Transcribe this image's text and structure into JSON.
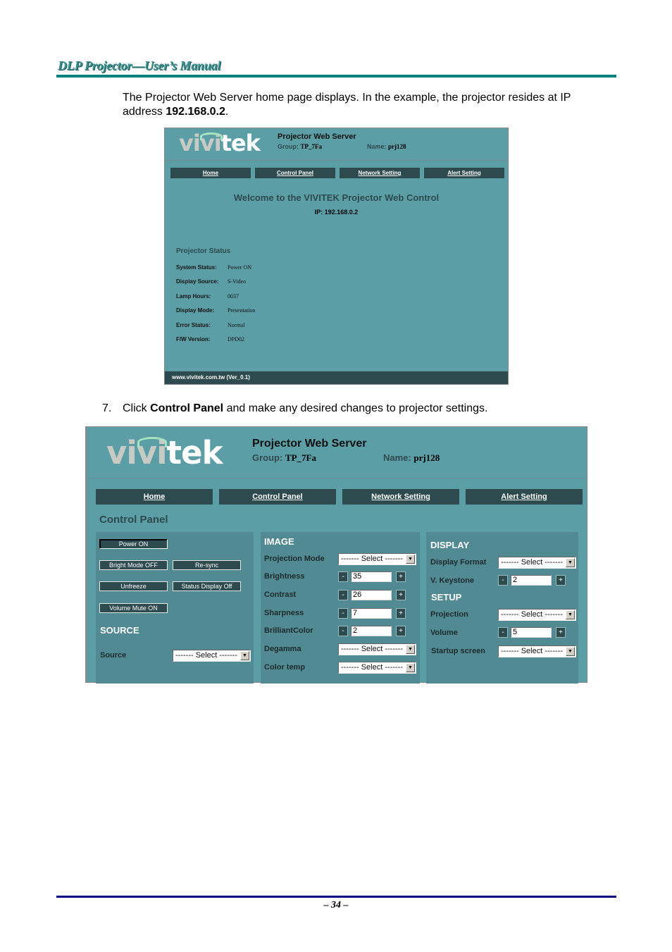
{
  "document": {
    "header_title": "DLP Projector—User’s Manual",
    "intro_text_1": "The Projector Web Server home page displays. In the example, the projector resides at IP address ",
    "intro_ip": "192.168.0.2",
    "intro_text_2": ".",
    "step_number": "7.",
    "step_text_1": "Click ",
    "step_bold": "Control Panel",
    "step_text_2": " and make any desired changes to projector settings.",
    "page_number": "– 34 –"
  },
  "web_header": {
    "logo_part1": "vivi",
    "logo_part2": "tek",
    "title": "Projector Web Server",
    "group_label": "Group: ",
    "group_value": "TP_7Fa",
    "name_label": "Name: ",
    "name_value": "prj128"
  },
  "nav": [
    {
      "label": "Home"
    },
    {
      "label": "Control Panel"
    },
    {
      "label": "Network Setting"
    },
    {
      "label": "Alert Setting"
    }
  ],
  "home_page": {
    "welcome": "Welcome to the VIVITEK Projector Web Control",
    "ip_label": "IP: ",
    "ip_value": "192.168.0.2",
    "status_title": "Projector Status",
    "status": [
      {
        "key": "System Status:",
        "value": "Power ON"
      },
      {
        "key": "Display Source:",
        "value": "S-Video"
      },
      {
        "key": "Lamp Hours:",
        "value": "0037"
      },
      {
        "key": "Display Mode:",
        "value": "Presentation"
      },
      {
        "key": "Error Status:",
        "value": "Normal"
      },
      {
        "key": "F/W Version:",
        "value": "DPD02"
      }
    ],
    "footer": "www.vivitek.com.tw (Ver_0.1)"
  },
  "control_panel": {
    "title": "Control Panel",
    "buttons": {
      "power": "Power ON",
      "bright_mode": "Bright Mode OFF",
      "resync": "Re-sync",
      "unfreeze": "Unfreeze",
      "status_display": "Status Display Off",
      "volume_mute": "Volume Mute ON"
    },
    "source_section": "SOURCE",
    "source_label": "Source",
    "select_placeholder": "------- Select -------",
    "image_section": "IMAGE",
    "image": {
      "projection_mode": "Projection Mode",
      "brightness": "Brightness",
      "brightness_value": "35",
      "contrast": "Contrast",
      "contrast_value": "26",
      "sharpness": "Sharpness",
      "sharpness_value": "7",
      "brilliant_color": "BrilliantColor",
      "brilliant_color_value": "2",
      "degamma": "Degamma",
      "color_temp": "Color temp"
    },
    "display_section": "DISPLAY",
    "display": {
      "display_format": "Display Format",
      "v_keystone": "V. Keystone",
      "v_keystone_value": "2"
    },
    "setup_section": "SETUP",
    "setup": {
      "projection": "Projection",
      "volume": "Volume",
      "volume_value": "5",
      "startup_screen": "Startup screen"
    },
    "minus": "-",
    "plus": "+",
    "arrow": "▼"
  }
}
